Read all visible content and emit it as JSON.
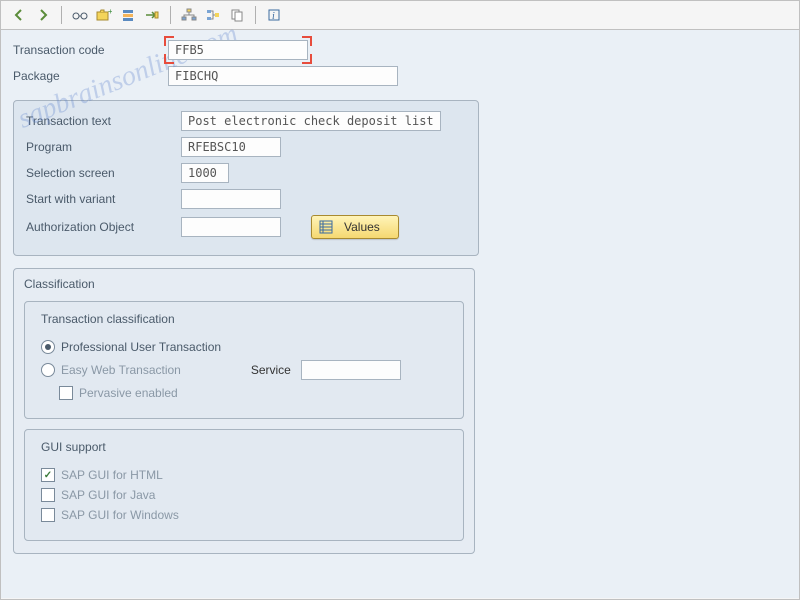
{
  "toolbar": {
    "icons": [
      "back",
      "forward",
      "sep",
      "glasses",
      "folder-plus",
      "overview",
      "transport",
      "sep",
      "hierarchy",
      "where-used",
      "copy",
      "sep",
      "info"
    ]
  },
  "header": {
    "tcode_label": "Transaction code",
    "tcode_value": "FFB5",
    "package_label": "Package",
    "package_value": "FIBCHQ"
  },
  "details": {
    "text_label": "Transaction text",
    "text_value": "Post electronic check deposit list",
    "program_label": "Program",
    "program_value": "RFEBSC10",
    "selscreen_label": "Selection screen",
    "selscreen_value": "1000",
    "variant_label": "Start with variant",
    "variant_value": "",
    "authobj_label": "Authorization Object",
    "authobj_value": "",
    "values_btn": "Values"
  },
  "classification": {
    "title": "Classification",
    "section1_title": "Transaction classification",
    "radio_professional": "Professional User Transaction",
    "radio_easyweb": "Easy Web Transaction",
    "service_label": "Service",
    "service_value": "",
    "check_pervasive": "Pervasive enabled",
    "section2_title": "GUI support",
    "check_html": "SAP GUI for HTML",
    "check_java": "SAP GUI for Java",
    "check_windows": "SAP GUI for Windows",
    "state": {
      "radio_selected": "professional",
      "pervasive": false,
      "gui_html": true,
      "gui_java": false,
      "gui_windows": false
    }
  },
  "watermark": "sapbrainsonline.com"
}
